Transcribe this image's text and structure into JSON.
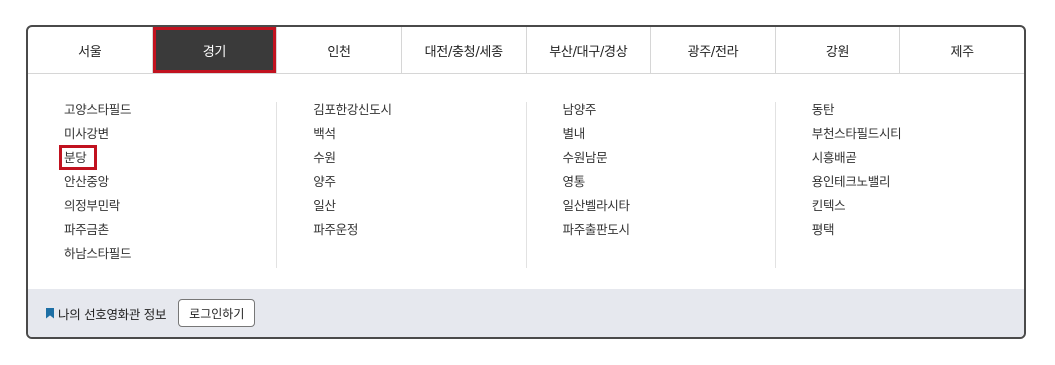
{
  "region_tabs": [
    {
      "label": "서울",
      "active": false
    },
    {
      "label": "경기",
      "active": true
    },
    {
      "label": "인천",
      "active": false
    },
    {
      "label": "대전/충청/세종",
      "active": false
    },
    {
      "label": "부산/대구/경상",
      "active": false
    },
    {
      "label": "광주/전라",
      "active": false
    },
    {
      "label": "강원",
      "active": false
    },
    {
      "label": "제주",
      "active": false
    }
  ],
  "theaters": {
    "col1": [
      "고양스타필드",
      "미사강변",
      "분당",
      "안산중앙",
      "의정부민락",
      "파주금촌",
      "하남스타필드"
    ],
    "col2": [
      "김포한강신도시",
      "백석",
      "수원",
      "양주",
      "일산",
      "파주운정"
    ],
    "col3": [
      "남양주",
      "별내",
      "수원남문",
      "영통",
      "일산벨라시타",
      "파주출판도시"
    ],
    "col4": [
      "동탄",
      "부천스타필드시티",
      "시흥배곧",
      "용인테크노밸리",
      "킨텍스",
      "평택"
    ]
  },
  "highlighted_theater": "분당",
  "footer": {
    "favorite_label": "나의 선호영화관 정보",
    "login_button": "로그인하기"
  },
  "colors": {
    "active_tab_bg": "#3a3a3a",
    "highlight_border": "#c1121f",
    "footer_bg": "#e6e8ee",
    "bookmark_icon": "#1d6fa5"
  }
}
